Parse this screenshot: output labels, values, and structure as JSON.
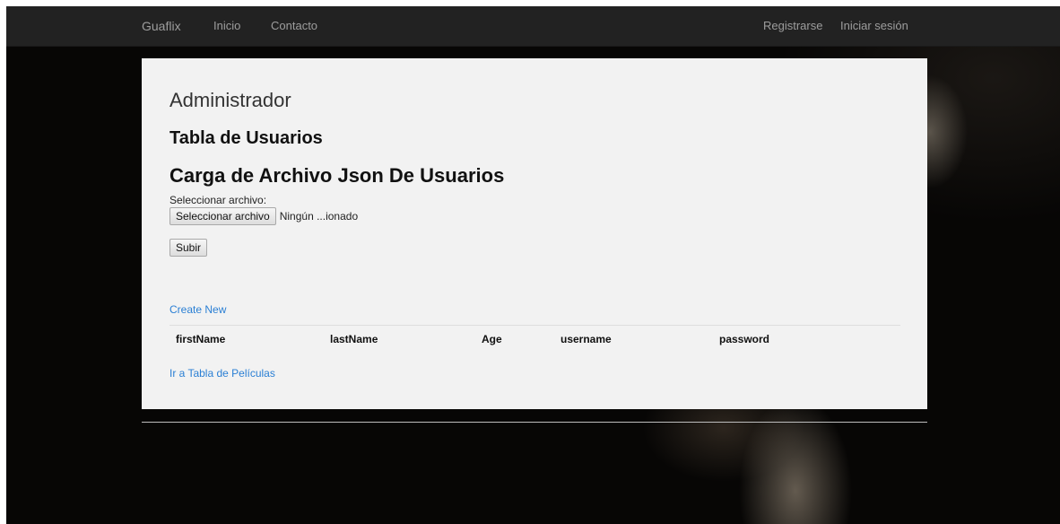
{
  "navbar": {
    "brand": "Guaflix",
    "left_links": [
      "Inicio",
      "Contacto"
    ],
    "right_links": [
      "Registrarse",
      "Iniciar sesión"
    ]
  },
  "main": {
    "title": "Administrador",
    "subtitle": "Tabla de Usuarios",
    "upload_heading": "Carga de Archivo Json De Usuarios",
    "file_label": "Seleccionar archivo:",
    "file_button_label": "Seleccionar archivo",
    "file_status": "Ningún ...ionado",
    "submit_label": "Subir",
    "create_new_label": "Create New",
    "table_headers": [
      "firstName",
      "lastName",
      "Age",
      "username",
      "password"
    ],
    "movies_link_label": "Ir a Tabla de Películas"
  },
  "colors": {
    "navbar_bg": "#222222",
    "nav_text": "#9d9d9d",
    "panel_bg": "#f2f2f2",
    "link": "#2a7fd4",
    "page_bg": "#060504"
  }
}
